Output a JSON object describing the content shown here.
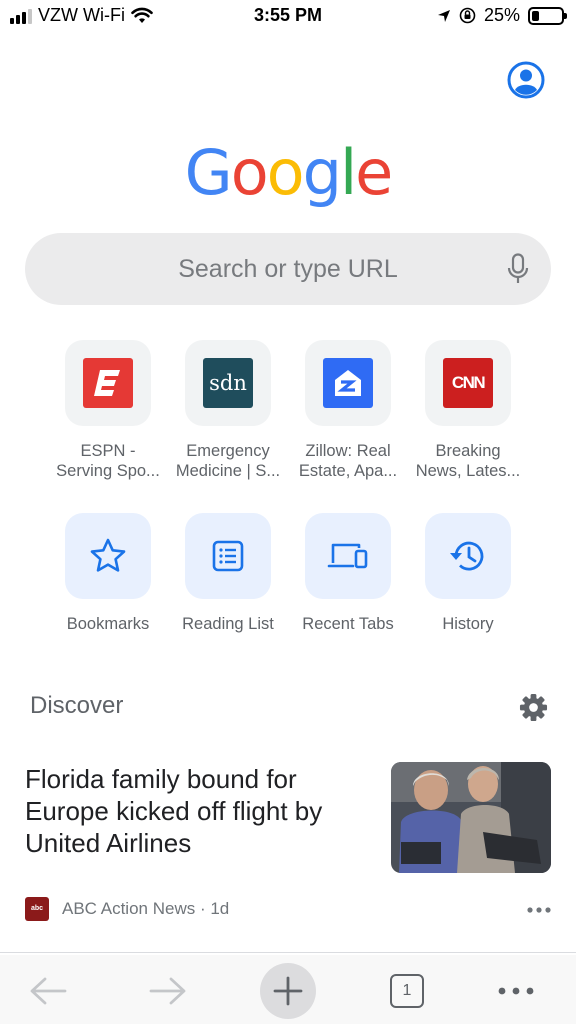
{
  "status_bar": {
    "carrier": "VZW Wi-Fi",
    "time": "3:55 PM",
    "battery": "25%",
    "battery_level": 0.25
  },
  "google_logo": {
    "letters": [
      "G",
      "o",
      "o",
      "g",
      "l",
      "e"
    ],
    "colors": [
      "#4285F4",
      "#EA4335",
      "#FBBC05",
      "#4285F4",
      "#34A853",
      "#EA4335"
    ]
  },
  "search": {
    "placeholder": "Search or type URL"
  },
  "shortcuts": [
    {
      "label": "ESPN -\nServing Spo...",
      "icon": "espn-icon"
    },
    {
      "label": "Emergency\nMedicine | S...",
      "icon": "sdn-icon",
      "icon_text": "sdn"
    },
    {
      "label": "Zillow: Real\nEstate, Apa...",
      "icon": "zillow-icon"
    },
    {
      "label": "Breaking\nNews, Lates...",
      "icon": "cnn-icon",
      "icon_text": "CNN"
    }
  ],
  "actions": [
    {
      "label": "Bookmarks",
      "icon": "star-icon"
    },
    {
      "label": "Reading List",
      "icon": "reading-list-icon"
    },
    {
      "label": "Recent Tabs",
      "icon": "devices-icon"
    },
    {
      "label": "History",
      "icon": "history-icon"
    }
  ],
  "discover": {
    "title": "Discover",
    "article": {
      "headline": "Florida family bound for Europe kicked off flight by United Airlines",
      "source_icon_text": "abc",
      "source": "ABC Action News · 1d"
    }
  },
  "toolbar": {
    "tab_count": "1"
  },
  "colors": {
    "accent": "#1a73e8",
    "icon_grey": "#5f6368"
  }
}
